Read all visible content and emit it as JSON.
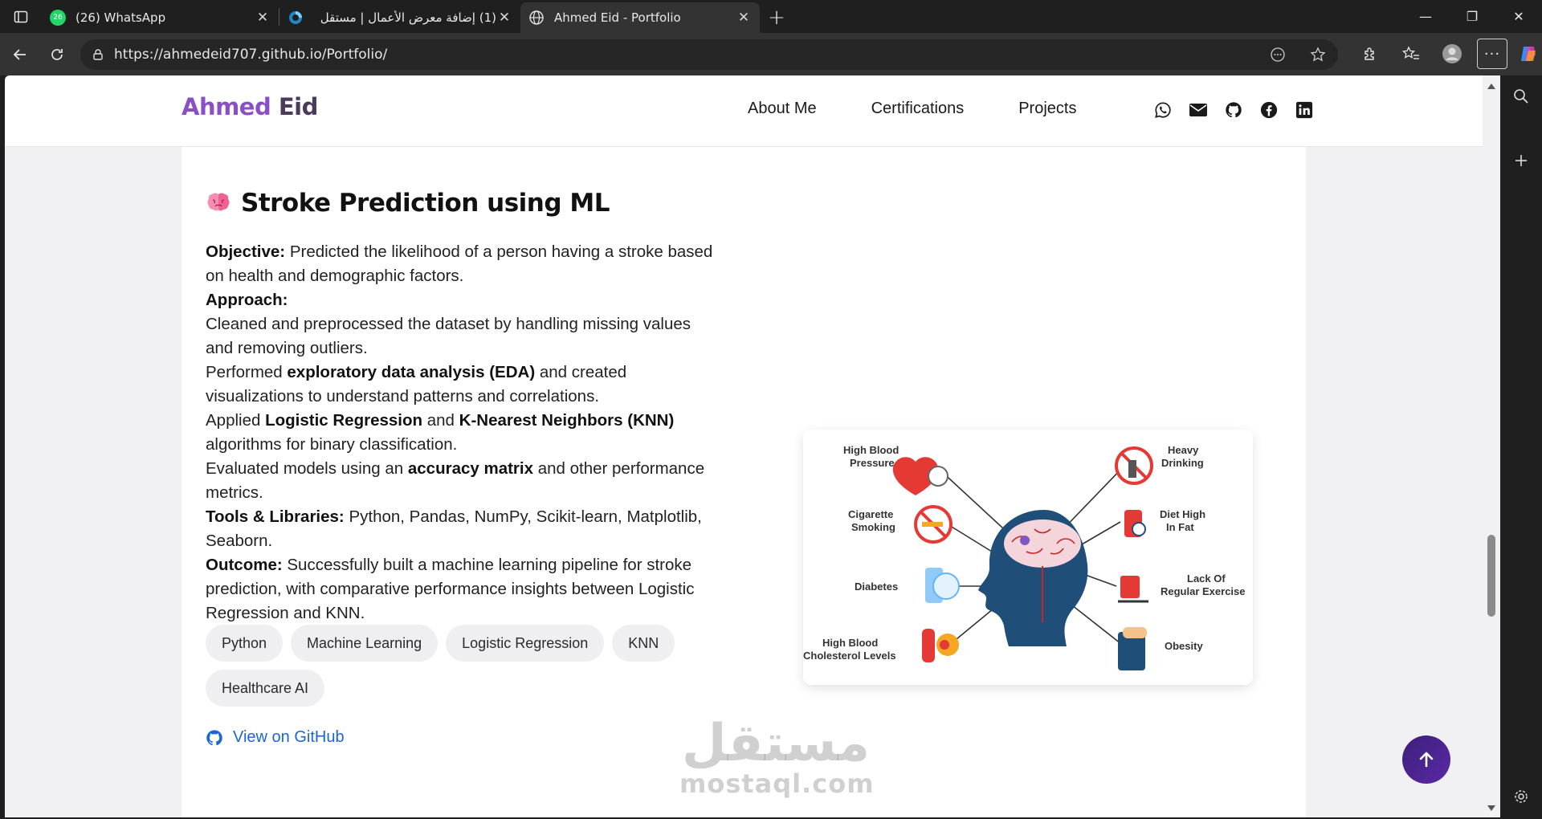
{
  "browser": {
    "tabs": [
      {
        "favicon": "whatsapp-icon",
        "badge": "26",
        "title": "(26) WhatsApp"
      },
      {
        "favicon": "mostaql-icon",
        "title": "(1) إضافة معرض الأعمال | مستقل"
      },
      {
        "favicon": "globe-icon",
        "title": "Ahmed Eid - Portfolio",
        "active": true
      }
    ],
    "url": "https://ahmedeid707.github.io/Portfolio/"
  },
  "site": {
    "brand_first": "Ahmed",
    "brand_last": "Eid",
    "nav": [
      "About Me",
      "Certifications",
      "Projects"
    ],
    "socials": [
      "whatsapp-icon",
      "envelope-icon",
      "github-icon",
      "facebook-icon",
      "linkedin-icon"
    ]
  },
  "project": {
    "emoji": "🧠",
    "title": "Stroke Prediction using ML",
    "objective_label": "Objective:",
    "objective_text": " Predicted the likelihood of a person having a stroke based on health and demographic factors.",
    "approach_label": "Approach:",
    "approach_1": "Cleaned and preprocessed the dataset by handling missing values and removing outliers.",
    "approach_2_a": "Performed ",
    "approach_2_b": "exploratory data analysis (EDA)",
    "approach_2_c": " and created visualizations to understand patterns and correlations.",
    "approach_3_a": "Applied ",
    "approach_3_b": "Logistic Regression",
    "approach_3_c": " and ",
    "approach_3_d": "K-Nearest Neighbors (KNN)",
    "approach_3_e": " algorithms for binary classification.",
    "approach_4_a": "Evaluated models using an ",
    "approach_4_b": "accuracy matrix",
    "approach_4_c": " and other performance metrics.",
    "tools_label": "Tools & Libraries:",
    "tools_text": " Python, Pandas, NumPy, Scikit-learn, Matplotlib, Seaborn.",
    "outcome_label": "Outcome:",
    "outcome_text": " Successfully built a machine learning pipeline for stroke prediction, with comparative performance insights between Logistic Regression and KNN.",
    "tags": [
      "Python",
      "Machine Learning",
      "Logistic Regression",
      "KNN",
      "Healthcare AI"
    ],
    "github_link": "View on GitHub",
    "figure_labels": {
      "high_bp_1": "High Blood",
      "high_bp_2": "Pressure",
      "cig_1": "Cigarette",
      "cig_2": "Smoking",
      "diabetes": "Diabetes",
      "chol_1": "High Blood",
      "chol_2": "Cholesterol Levels",
      "drink_1": "Heavy",
      "drink_2": "Drinking",
      "fat_1": "Diet High",
      "fat_2": "In Fat",
      "ex_1": "Lack Of",
      "ex_2": "Regular Exercise",
      "obesity": "Obesity"
    }
  },
  "watermark": {
    "arabic": "مستقل",
    "latin": "mostaql.com"
  }
}
